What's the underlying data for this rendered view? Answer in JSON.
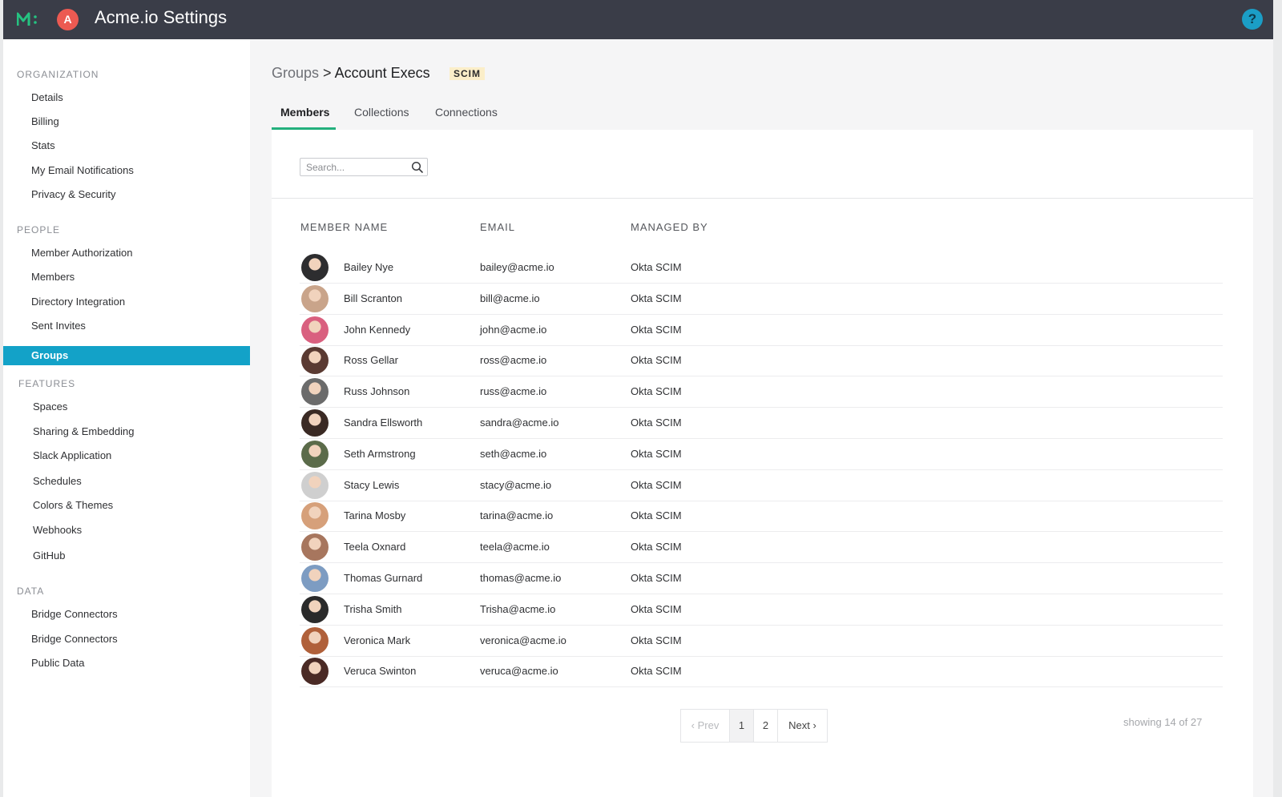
{
  "app": {
    "title": "Acme.io Settings",
    "avatar_letter": "A",
    "help_label": "?"
  },
  "sidebar": {
    "sections": [
      {
        "title": "ORGANIZATION",
        "items": [
          "Details",
          "Billing",
          "Stats",
          "My Email Notifications",
          "Privacy & Security"
        ]
      },
      {
        "title": "PEOPLE",
        "items": [
          "Member Authorization",
          "Members",
          "Directory Integration",
          "Sent Invites",
          "Groups"
        ]
      },
      {
        "title": "FEATURES",
        "items": [
          "Spaces",
          "Sharing & Embedding",
          "Slack Application",
          "Schedules",
          "Colors & Themes",
          "Webhooks",
          "GitHub"
        ]
      },
      {
        "title": "DATA",
        "items": [
          "Bridge Connectors",
          "Bridge Connectors",
          "Public Data"
        ]
      }
    ],
    "active_item": "Groups"
  },
  "breadcrumb": {
    "parent": "Groups",
    "separator": ">",
    "current": "Account Execs",
    "badge": "SCIM"
  },
  "tabs": [
    {
      "label": "Members",
      "active": true
    },
    {
      "label": "Collections",
      "active": false
    },
    {
      "label": "Connections",
      "active": false
    }
  ],
  "search": {
    "placeholder": "Search...",
    "value": ""
  },
  "table": {
    "columns": [
      "MEMBER NAME",
      "EMAIL",
      "MANAGED BY"
    ],
    "rows": [
      {
        "name": "Bailey Nye",
        "email": "bailey@acme.io",
        "managed_by": "Okta SCIM"
      },
      {
        "name": "Bill Scranton",
        "email": "bill@acme.io",
        "managed_by": "Okta SCIM"
      },
      {
        "name": "John Kennedy",
        "email": "john@acme.io",
        "managed_by": "Okta SCIM"
      },
      {
        "name": "Ross Gellar",
        "email": "ross@acme.io",
        "managed_by": "Okta SCIM"
      },
      {
        "name": "Russ Johnson",
        "email": "russ@acme.io",
        "managed_by": "Okta SCIM"
      },
      {
        "name": "Sandra Ellsworth",
        "email": "sandra@acme.io",
        "managed_by": "Okta SCIM"
      },
      {
        "name": "Seth Armstrong",
        "email": "seth@acme.io",
        "managed_by": "Okta SCIM"
      },
      {
        "name": "Stacy Lewis",
        "email": "stacy@acme.io",
        "managed_by": "Okta SCIM"
      },
      {
        "name": "Tarina Mosby",
        "email": "tarina@acme.io",
        "managed_by": "Okta SCIM"
      },
      {
        "name": "Teela Oxnard",
        "email": "teela@acme.io",
        "managed_by": "Okta SCIM"
      },
      {
        "name": "Thomas Gurnard",
        "email": "thomas@acme.io",
        "managed_by": "Okta SCIM"
      },
      {
        "name": "Trisha Smith",
        "email": "Trisha@acme.io",
        "managed_by": "Okta SCIM"
      },
      {
        "name": "Veronica Mark",
        "email": "veronica@acme.io",
        "managed_by": "Okta SCIM"
      },
      {
        "name": "Veruca Swinton",
        "email": "veruca@acme.io",
        "managed_by": "Okta SCIM"
      }
    ]
  },
  "pagination": {
    "prev": "‹ Prev",
    "pages": [
      "1",
      "2"
    ],
    "current_page": "1",
    "next": "Next ›",
    "status": "showing 14 of 27"
  },
  "colors": {
    "topbar": "#3a3d48",
    "accent_active_nav": "#13a2c8",
    "tab_underline": "#23b07d",
    "avatar_badge": "#ec5a52",
    "help_icon": "#1b9ec6",
    "scim_badge_bg": "#fbeec9"
  },
  "icons": {
    "logo": "m-logo-icon",
    "search": "search-icon",
    "help": "help-icon"
  }
}
